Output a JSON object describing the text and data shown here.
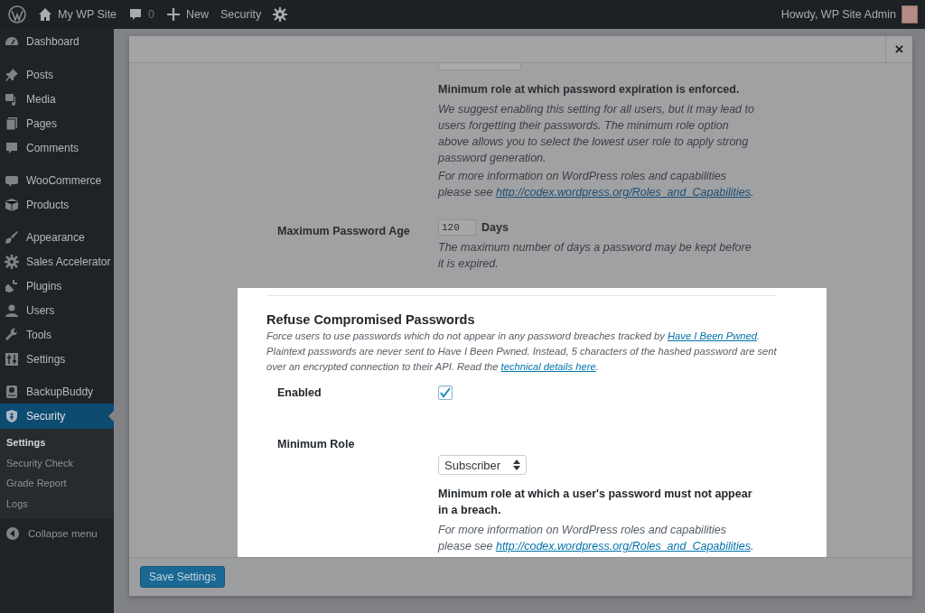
{
  "admin_bar": {
    "site_name": "My WP Site",
    "comments_count": "0",
    "new_label": "New",
    "security_label": "Security",
    "greeting": "Howdy, WP Site Admin"
  },
  "sidebar": {
    "groups": [
      {
        "items": [
          {
            "label": "Dashboard",
            "selected": false
          }
        ]
      },
      {
        "items": [
          {
            "label": "Posts",
            "selected": false
          },
          {
            "label": "Media",
            "selected": false
          },
          {
            "label": "Pages",
            "selected": false
          },
          {
            "label": "Comments",
            "selected": false
          }
        ]
      },
      {
        "items": [
          {
            "label": "WooCommerce",
            "selected": false
          },
          {
            "label": "Products",
            "selected": false
          }
        ]
      },
      {
        "items": [
          {
            "label": "Appearance",
            "selected": false
          },
          {
            "label": "Sales Accelerator",
            "selected": false
          },
          {
            "label": "Plugins",
            "selected": false
          },
          {
            "label": "Users",
            "selected": false
          },
          {
            "label": "Tools",
            "selected": false
          },
          {
            "label": "Settings",
            "selected": false
          }
        ]
      },
      {
        "items": [
          {
            "label": "BackupBuddy",
            "selected": false
          },
          {
            "label": "Security",
            "selected": true,
            "children": [
              {
                "label": "Settings",
                "selected": true
              },
              {
                "label": "Security Check",
                "selected": false
              },
              {
                "label": "Grade Report",
                "selected": false
              },
              {
                "label": "Logs",
                "selected": false
              }
            ]
          }
        ]
      }
    ],
    "collapse_label": "Collapse menu"
  },
  "modal": {
    "close_label": "×",
    "upper_rows": [
      {
        "kind": "select",
        "description_bold": "Minimum role at which password expiration is enforced.",
        "notes": [
          [
            {
              "text": "We suggest enabling this setting for all users, but it may lead to users forgetting their passwords. The minimum role option above allows you to select the lowest user role to apply strong password generation."
            }
          ],
          [
            {
              "text": "For more information on WordPress roles and capabilities please see "
            },
            {
              "link": "http://codex.wordpress.org/Roles_and_Capabilities"
            },
            {
              "text": "."
            }
          ]
        ]
      },
      {
        "kind": "number",
        "label": "Maximum Password Age",
        "value": "120",
        "unit": "Days",
        "notes": [
          [
            {
              "text": "The maximum number of days a password may be kept before it is expired."
            }
          ]
        ]
      }
    ],
    "section": {
      "title": "Refuse Compromised Passwords",
      "description": [
        {
          "text": "Force users to use passwords which do not appear in any password breaches tracked by "
        },
        {
          "link": "Have I Been Pwned"
        },
        {
          "text": ". Plaintext passwords are never sent to Have I Been Pwned. Instead, 5 characters of the hashed password are sent over an encrypted connection to their API. Read the "
        },
        {
          "link": "technical details here"
        },
        {
          "text": "."
        }
      ],
      "rows": [
        {
          "kind": "checkbox",
          "label": "Enabled",
          "checked": true
        },
        {
          "kind": "select",
          "label": "Minimum Role",
          "value": "Subscriber",
          "description_bold": "Minimum role at which a user's password must not appear in a breach.",
          "notes": [
            [
              {
                "text": "For more information on WordPress roles and capabilities please see "
              },
              {
                "link": "http://codex.wordpress.org/Roles_and_Capabilities"
              },
              {
                "text": "."
              }
            ]
          ]
        }
      ]
    },
    "save_button": "Save Settings"
  }
}
